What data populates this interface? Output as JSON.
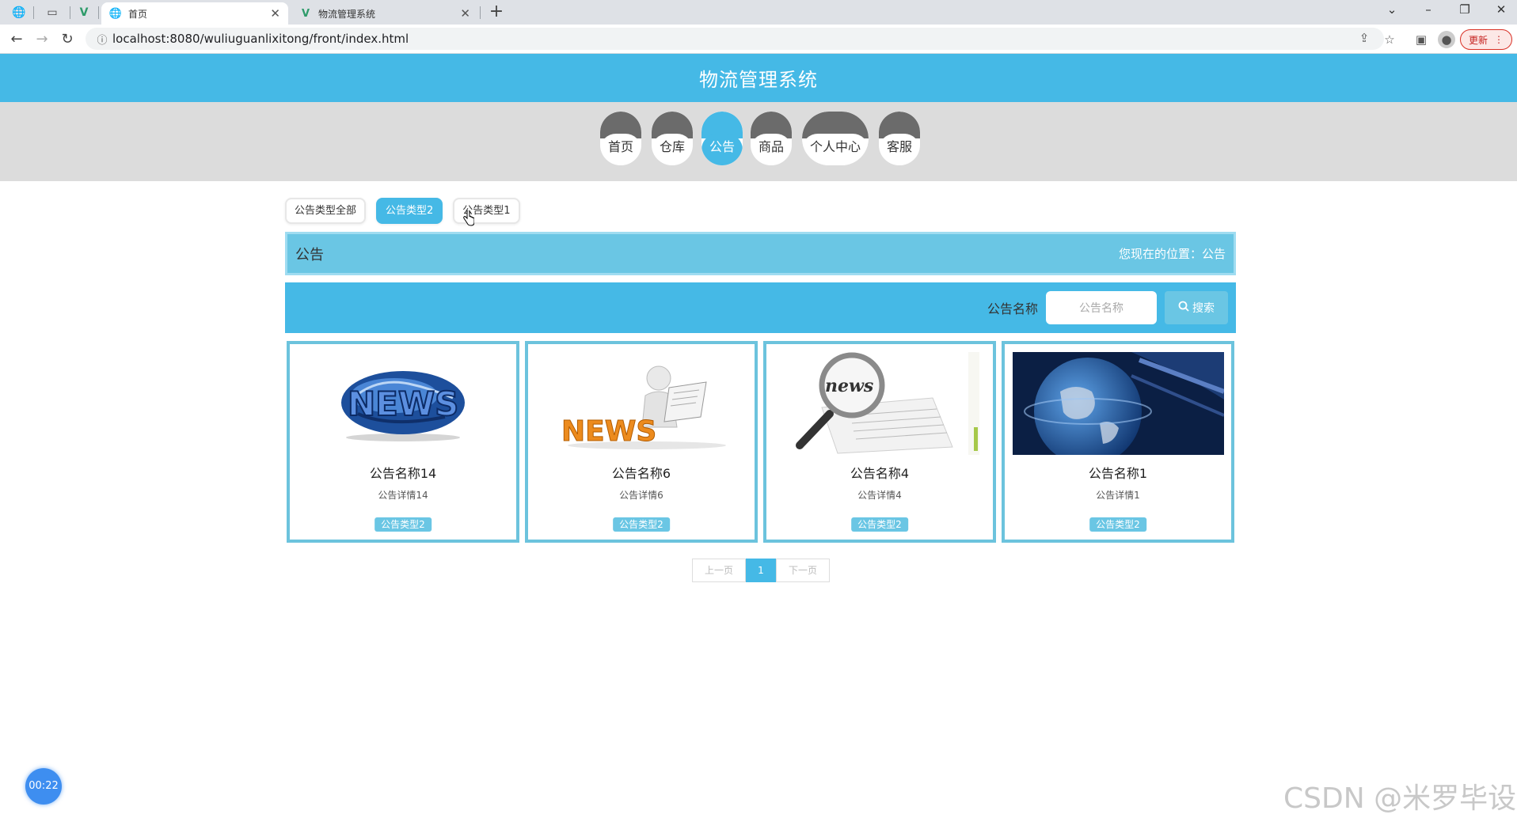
{
  "browser": {
    "tabs": [
      {
        "title": "首页",
        "active": true
      },
      {
        "title": "物流管理系统",
        "active": false
      }
    ],
    "url": "localhost:8080/wuliuguanlixitong/front/index.html",
    "update_label": "更新"
  },
  "site": {
    "title": "物流管理系统",
    "nav": [
      {
        "label": "首页",
        "active": false
      },
      {
        "label": "仓库",
        "active": false
      },
      {
        "label": "公告",
        "active": true
      },
      {
        "label": "商品",
        "active": false
      },
      {
        "label": "个人中心",
        "active": false
      },
      {
        "label": "客服",
        "active": false
      }
    ]
  },
  "filters": [
    {
      "label": "公告类型全部",
      "active": false
    },
    {
      "label": "公告类型2",
      "active": true
    },
    {
      "label": "公告类型1",
      "active": false
    }
  ],
  "breadcrumb": {
    "section": "公告",
    "location": "您现在的位置：公告"
  },
  "search": {
    "label": "公告名称",
    "placeholder": "公告名称",
    "button": "搜索"
  },
  "cards": [
    {
      "name": "公告名称14",
      "desc": "公告详情14",
      "tag": "公告类型2",
      "image": "news-globe-image"
    },
    {
      "name": "公告名称6",
      "desc": "公告详情6",
      "tag": "公告类型2",
      "image": "news-figure-image"
    },
    {
      "name": "公告名称4",
      "desc": "公告详情4",
      "tag": "公告类型2",
      "image": "news-magnifier-image"
    },
    {
      "name": "公告名称1",
      "desc": "公告详情1",
      "tag": "公告类型2",
      "image": "earth-broadcast-image"
    }
  ],
  "pager": {
    "prev": "上一页",
    "current": "1",
    "next": "下一页"
  },
  "timer": "00:22",
  "watermark": "CSDN @米罗毕设",
  "colors": {
    "primary": "#45b9e6",
    "light": "#6ac6e4",
    "nav_dark": "#6b6b6b",
    "card_border": "#6cc3dd"
  }
}
